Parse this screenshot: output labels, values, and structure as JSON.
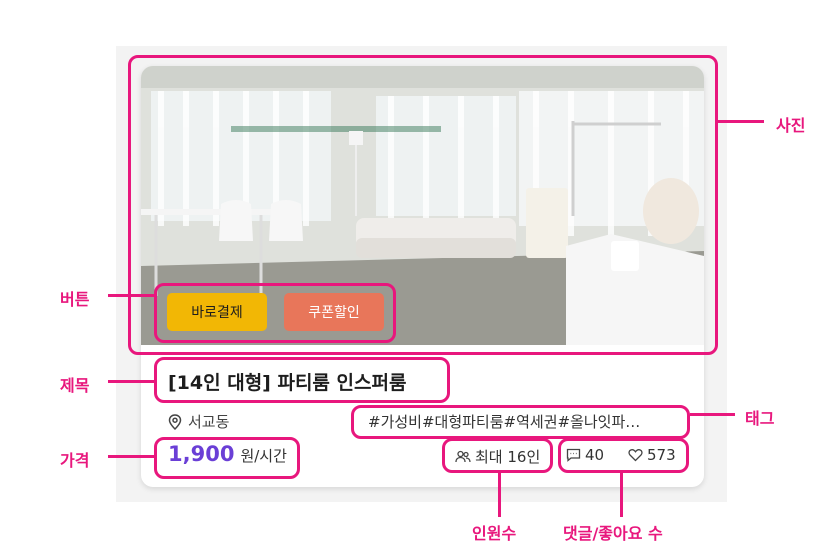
{
  "card": {
    "buttons": {
      "pay_label": "바로결제",
      "coupon_label": "쿠폰할인"
    },
    "title": "[14인 대형] 파티룸 인스퍼룸",
    "location": "서교동",
    "tags": "#가성비#대형파티룸#역세권#올나잇파…",
    "price": {
      "amount": "1,900",
      "unit": "원/시간"
    },
    "capacity": "최대 16인",
    "comments": "40",
    "likes": "573"
  },
  "annotations": {
    "photo": "사진",
    "buttons": "버튼",
    "title": "제목",
    "tags": "태그",
    "price": "가격",
    "capacity": "인원수",
    "comments_likes": "댓글/좋아요 수"
  },
  "colors": {
    "annotation": "#e8177d",
    "price": "#6a3fd6",
    "pay_button": "#f2b705",
    "coupon_button": "#e8765a"
  },
  "icons": [
    "location-pin-icon",
    "people-icon",
    "comment-icon",
    "heart-icon"
  ]
}
